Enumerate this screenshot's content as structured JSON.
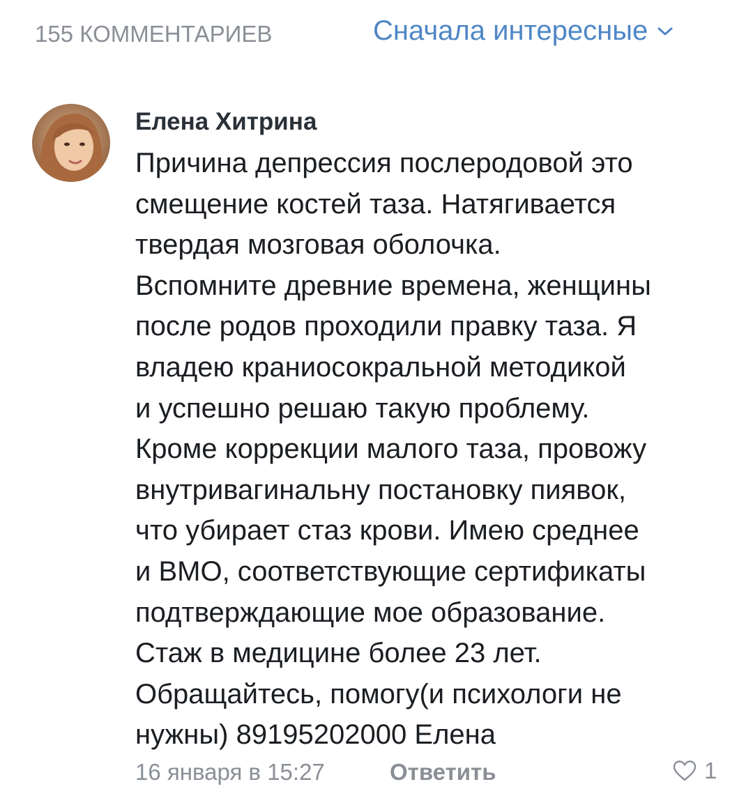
{
  "header": {
    "comments_count": "155 КОММЕНТАРИЕВ",
    "sort_label": "Сначала интересные",
    "sort_icon": "chevron-down-icon",
    "accent_color": "#4f86c6"
  },
  "comment": {
    "author": "Елена Хитрина",
    "avatar_icon": "user-avatar",
    "lines": [
      "Причина депрессия послеродовой это",
      "смещение костей таза. Натягивается",
      "твердая мозговая оболочка.",
      "Вспомните древние времена, женщины",
      "после родов проходили правку таза. Я",
      "владею краниосокральной методикой",
      "и успешно решаю такую проблему.",
      "Кроме коррекции малого таза, провожу",
      "внутривагинальну постановку пиявок,",
      "что убирает стаз крови. Имею среднее",
      "и ВМО, соответствующие сертификаты",
      "подтверждающие мое образование.",
      "Стаж в медицине более 23 лет.",
      "Обращайтесь, помогу(и психологи не",
      "нужны) 89195202000 Елена"
    ],
    "date": "16 января в 15:27",
    "reply_label": "Ответить",
    "like_icon": "heart-icon",
    "like_count": "1"
  }
}
